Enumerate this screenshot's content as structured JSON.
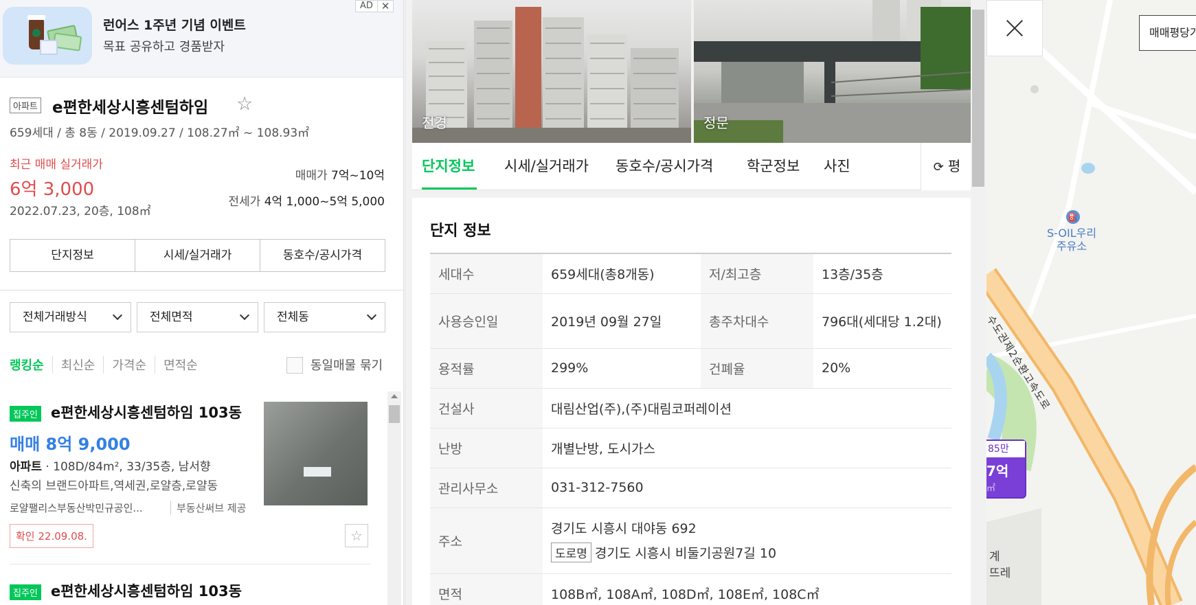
{
  "ad": {
    "title": "런어스 1주년 기념 이벤트",
    "subtitle": "목표 공유하고 경품받자",
    "badge_ad": "AD",
    "badge_close": "✕"
  },
  "complex": {
    "type": "아파트",
    "name": "e편한세상시흥센텀하임",
    "meta": "659세대 / 총 8동 / 2019.09.27 / 108.27㎡ ~ 108.93㎡",
    "recent_label": "최근 매매 실거래가",
    "recent_price": "6억 3,000",
    "recent_date": "2022.07.23, 20층, 108㎡",
    "sale_label": "매매가",
    "sale_value": "7억~10억",
    "jeonse_label": "전세가",
    "jeonse_value": "4억 1,000~5억 5,000",
    "tabs": [
      "단지정보",
      "시세/실거래가",
      "동호수/공시가격"
    ]
  },
  "filters": [
    "전체거래방식",
    "전체면적",
    "전체동"
  ],
  "sort": [
    "랭킹순",
    "최신순",
    "가격순",
    "면적순"
  ],
  "group_label": "동일매물 묶기",
  "listings": [
    {
      "badge": "집주인",
      "title": "e편한세상시흥센텀하임 103동",
      "price": "매매 8억 9,000",
      "type": "아파트",
      "spec": " · 108D/84m², 33/35층, 남서향",
      "desc": "신축의 브랜드아파트,역세권,로얄층,로얄동",
      "agent": "로얄팰리스부동산박민규공인...",
      "provider": "부동산써브 제공",
      "confirm": "확인 22.09.08."
    },
    {
      "badge": "집주인",
      "title": "e편한세상시흥센텀하임 103동"
    }
  ],
  "photos": [
    "전경",
    "정문"
  ],
  "tabs": [
    "단지정보",
    "시세/실거래가",
    "동호수/공시가격",
    "학군정보",
    "사진"
  ],
  "pyeong_btn": "평",
  "info": {
    "title": "단지 정보",
    "rows": [
      {
        "k1": "세대수",
        "v1": "659세대(총8개동)",
        "k2": "저/최고층",
        "v2": "13층/35층"
      },
      {
        "k1": "사용승인일",
        "v1": "2019년 09월 27일",
        "k2": "총주차대수",
        "v2": "796대(세대당 1.2대)"
      },
      {
        "k1": "용적률",
        "v1": "299%",
        "k2": "건폐율",
        "v2": "20%"
      },
      {
        "k1": "건설사",
        "v1": "대림산업(주),(주)대림코퍼레이션"
      },
      {
        "k1": "난방",
        "v1": "개별난방, 도시가스"
      },
      {
        "k1": "관리사무소",
        "v1": "031-312-7560"
      },
      {
        "k1": "주소",
        "v1": "경기도 시흥시 대야동 692",
        "road_badge": "도로명",
        "road": "경기도 시흥시 비둘기공원7길 10"
      },
      {
        "k1": "면적",
        "v1": "108B㎡, 108A㎡, 108D㎡, 108E㎡, 108C㎡"
      }
    ]
  },
  "map": {
    "button": "매매평당가",
    "poi_line1": "S-OIL우리",
    "poi_line2": "주유소",
    "poi_icon": "⛽",
    "road": "수도권제2순환고속도로",
    "marker_top": "85만",
    "marker_price": "7억",
    "marker_unit": "㎡",
    "text1": "계",
    "text2": "뜨레"
  },
  "colors": {
    "accent": "#03c75a",
    "price_red": "#e04c4c",
    "listing_blue": "#3380e5",
    "marker_purple": "#7a3fd6"
  }
}
